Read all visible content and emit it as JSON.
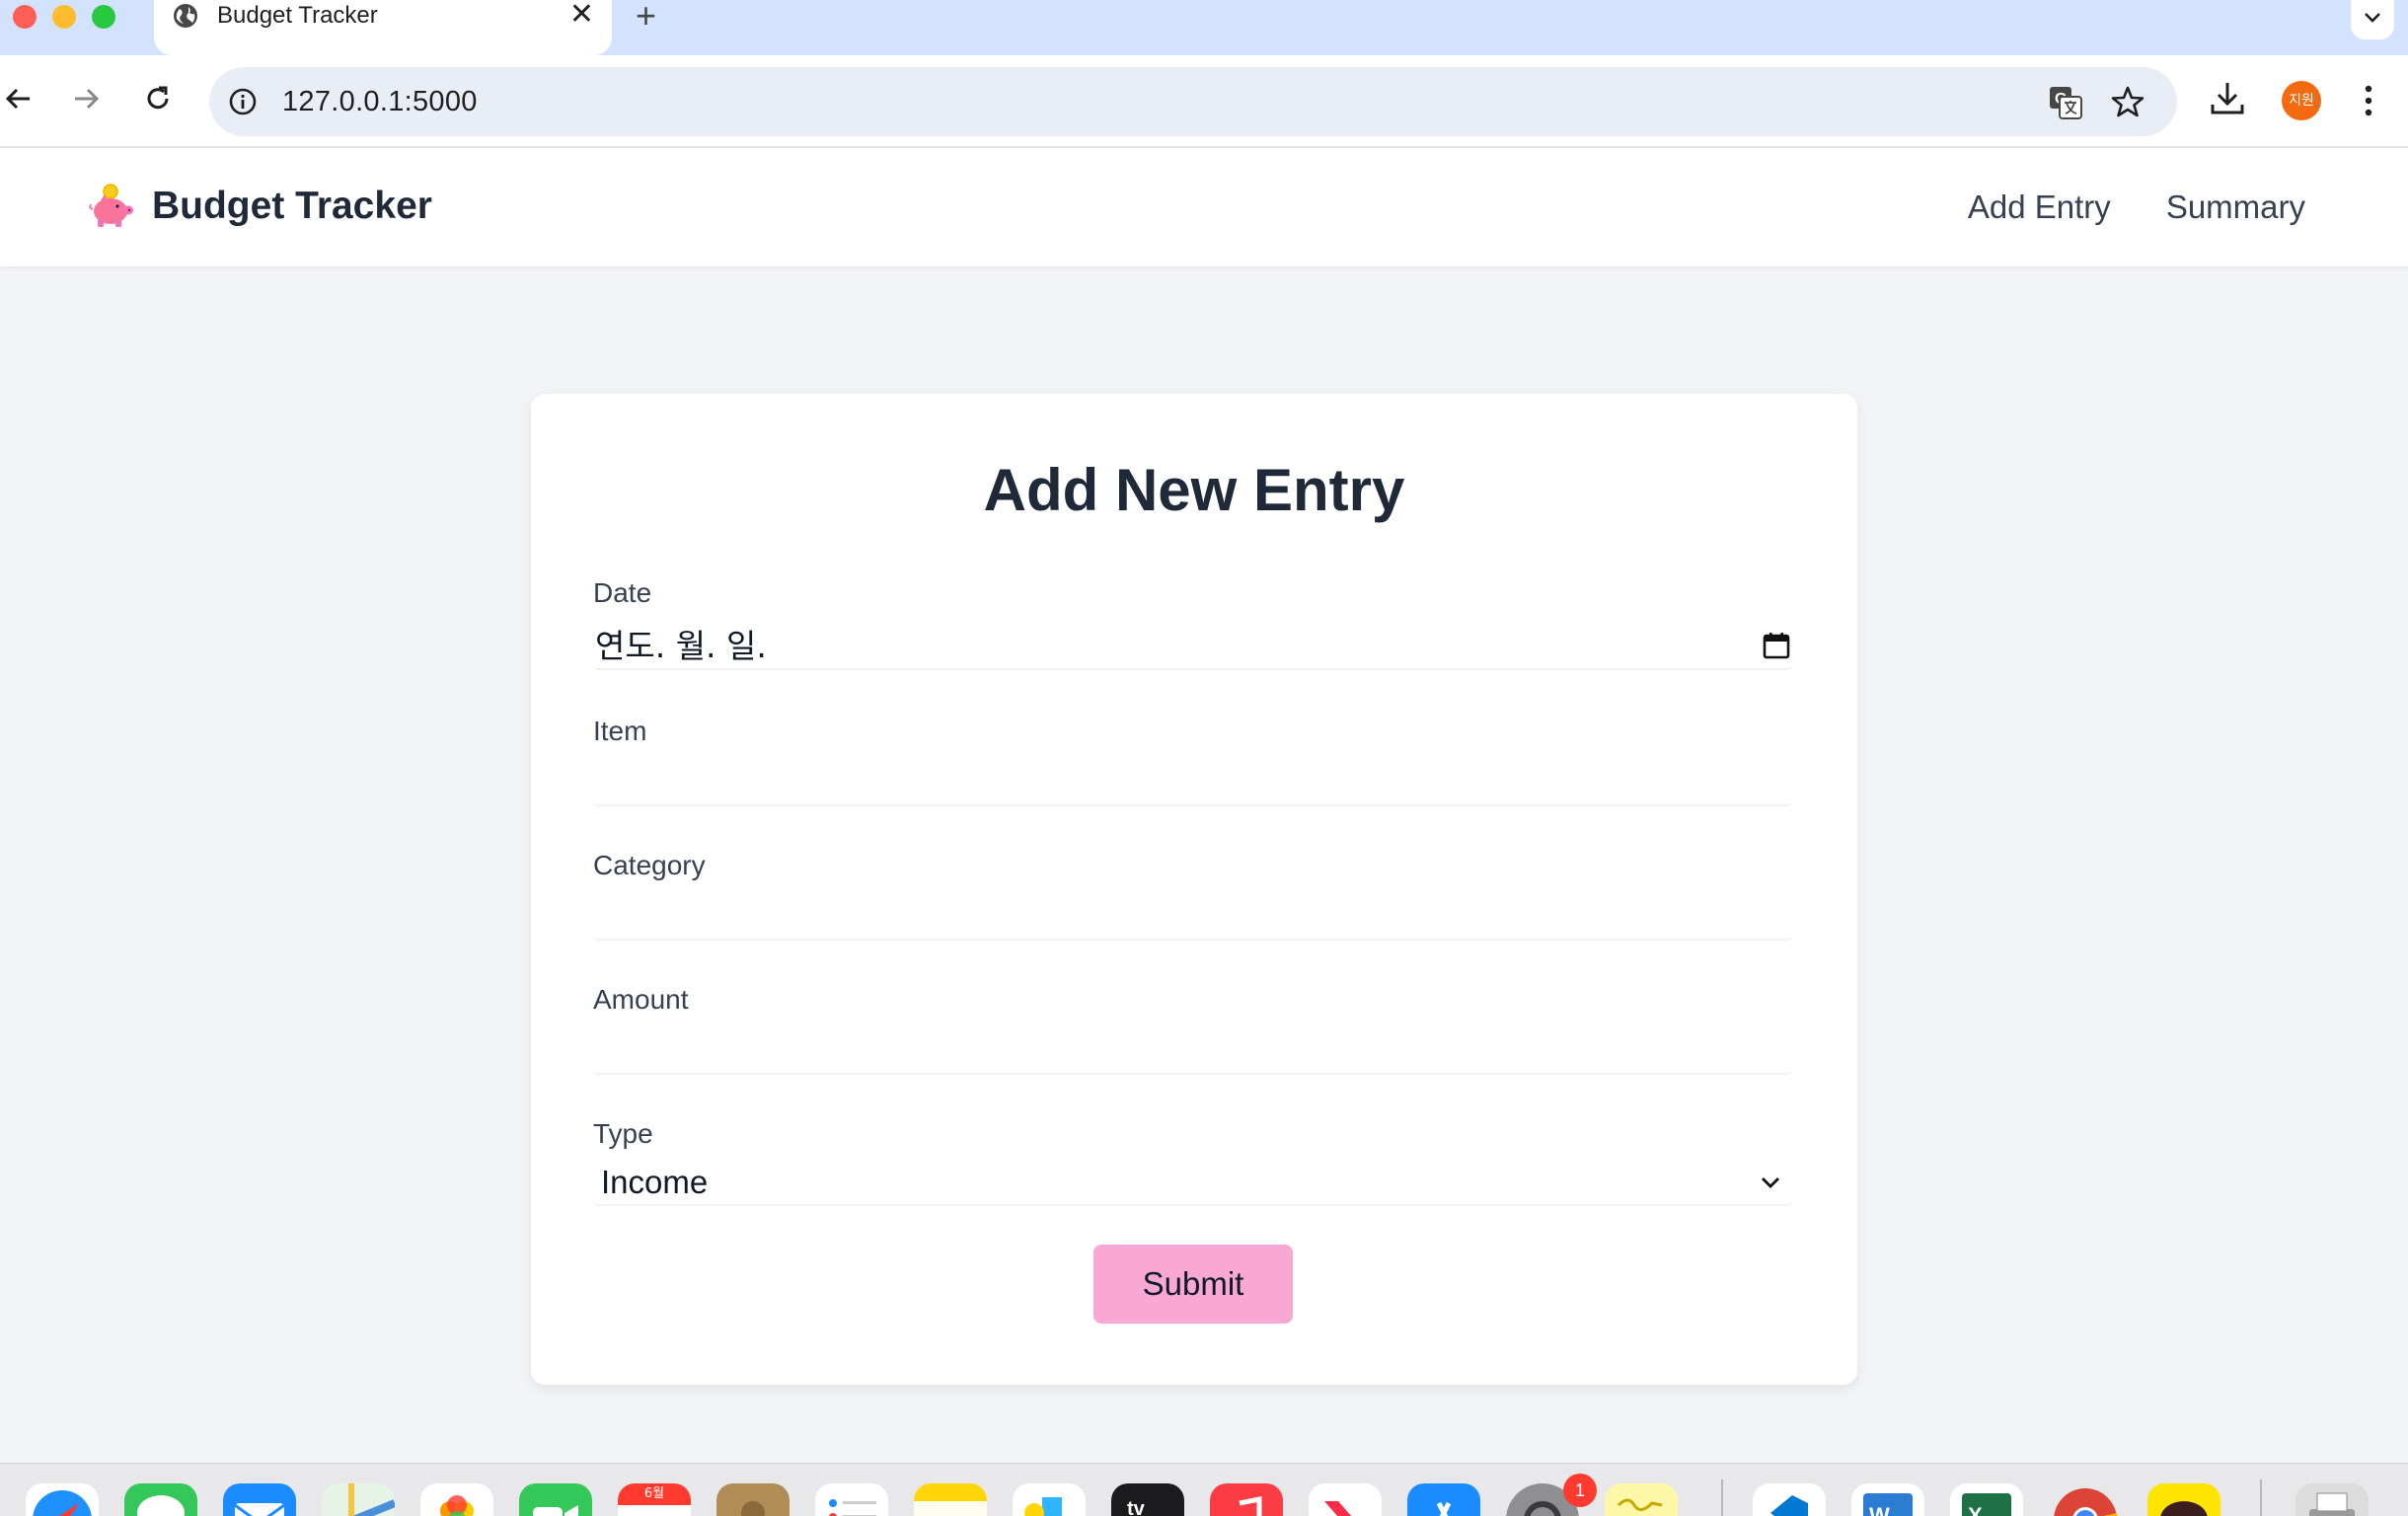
{
  "browser": {
    "tab_title": "Budget Tracker",
    "new_tab_symbol": "+",
    "url": "127.0.0.1:5000",
    "profile_label": "지원"
  },
  "app": {
    "brand_title": "Budget Tracker",
    "brand_icon": "piggy-bank-icon",
    "nav": [
      {
        "label": "Add Entry"
      },
      {
        "label": "Summary"
      }
    ]
  },
  "form": {
    "title": "Add New Entry",
    "date": {
      "label": "Date",
      "placeholder": "연도. 월. 일."
    },
    "item": {
      "label": "Item",
      "value": ""
    },
    "category": {
      "label": "Category",
      "value": ""
    },
    "amount": {
      "label": "Amount",
      "value": ""
    },
    "type": {
      "label": "Type",
      "value": "Income"
    },
    "submit_label": "Submit",
    "accent_color": "#f9a8d4"
  },
  "dock": {
    "calendar_month": "6월",
    "settings_badge": "1",
    "apps": [
      "safari-icon",
      "messages-icon",
      "mail-icon",
      "maps-icon",
      "photos-icon",
      "facetime-icon",
      "calendar-icon",
      "contacts-icon",
      "reminders-icon",
      "notes-icon",
      "freeform-icon",
      "apple-tv-icon",
      "music-icon",
      "news-icon",
      "app-store-icon",
      "system-settings-icon",
      "preview-icon",
      "vscode-icon",
      "word-icon",
      "excel-icon",
      "chrome-icon",
      "kakaotalk-icon",
      "printer-icon"
    ]
  }
}
